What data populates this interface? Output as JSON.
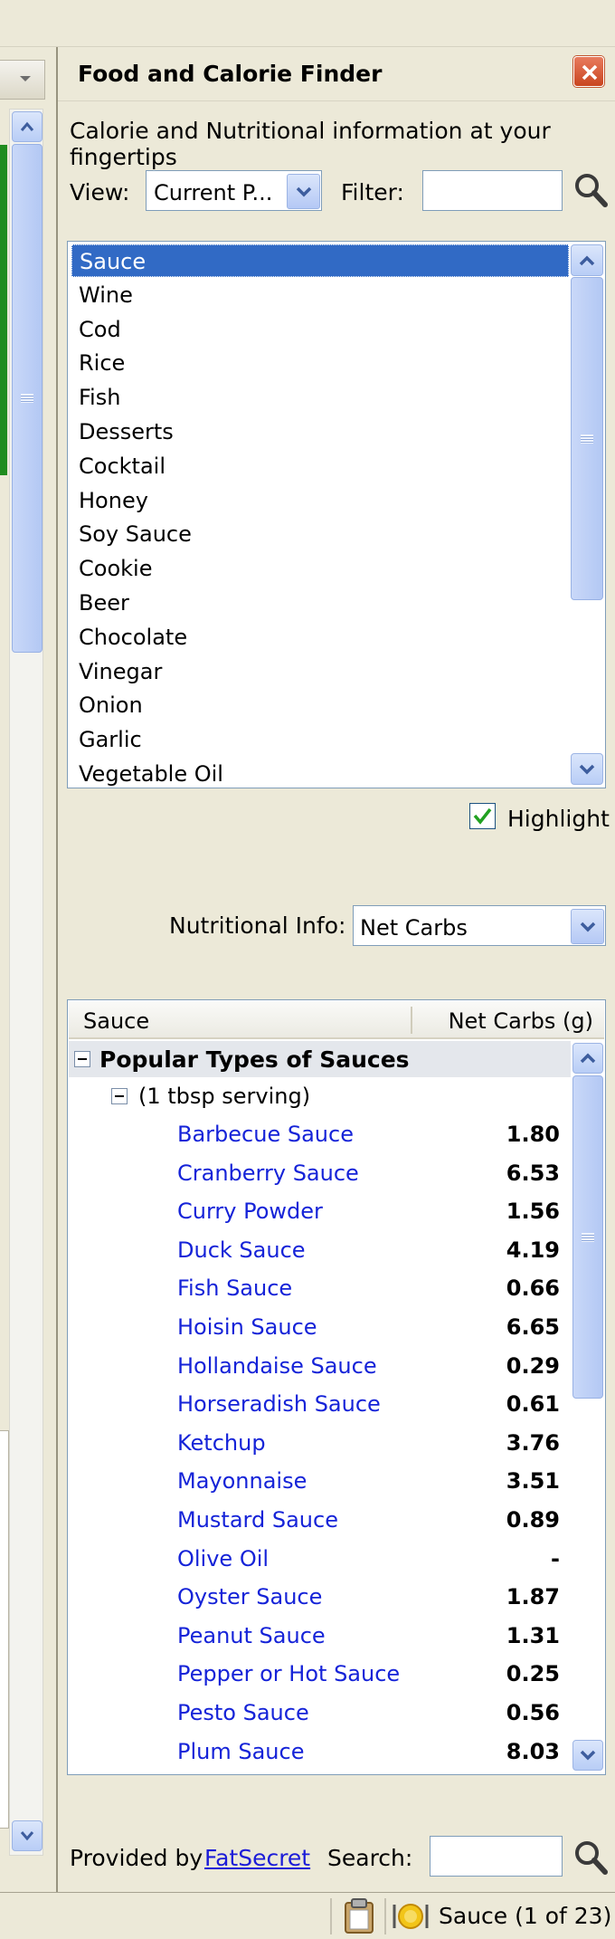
{
  "panel": {
    "title": "Food and Calorie Finder",
    "tagline": "Calorie and Nutritional information at your fingertips"
  },
  "view": {
    "label": "View:",
    "selected": "Current P..."
  },
  "filter": {
    "label": "Filter:",
    "value": ""
  },
  "food_list": {
    "items": [
      "Sauce",
      "Wine",
      "Cod",
      "Rice",
      "Fish",
      "Desserts",
      "Cocktail",
      "Honey",
      "Soy Sauce",
      "Cookie",
      "Beer",
      "Chocolate",
      "Vinegar",
      "Onion",
      "Garlic",
      "Vegetable Oil"
    ],
    "selected_index": 0
  },
  "highlight": {
    "label": "Highlight",
    "checked": true
  },
  "nutritional_info": {
    "label": "Nutritional Info:",
    "selected": "Net Carbs"
  },
  "grid": {
    "columns": [
      "Sauce",
      "Net Carbs (g)"
    ],
    "group": "Popular Types of Sauces",
    "subgroup": "(1 tbsp serving)",
    "rows": [
      {
        "name": "Barbecue Sauce",
        "value": "1.80"
      },
      {
        "name": "Cranberry Sauce",
        "value": "6.53"
      },
      {
        "name": "Curry Powder",
        "value": "1.56"
      },
      {
        "name": "Duck Sauce",
        "value": "4.19"
      },
      {
        "name": "Fish Sauce",
        "value": "0.66"
      },
      {
        "name": "Hoisin Sauce",
        "value": "6.65"
      },
      {
        "name": "Hollandaise Sauce",
        "value": "0.29"
      },
      {
        "name": "Horseradish Sauce",
        "value": "0.61"
      },
      {
        "name": "Ketchup",
        "value": "3.76"
      },
      {
        "name": "Mayonnaise",
        "value": "3.51"
      },
      {
        "name": "Mustard Sauce",
        "value": "0.89"
      },
      {
        "name": "Olive Oil",
        "value": "-"
      },
      {
        "name": "Oyster Sauce",
        "value": "1.87"
      },
      {
        "name": "Peanut Sauce",
        "value": "1.31"
      },
      {
        "name": "Pepper or Hot Sauce",
        "value": "0.25"
      },
      {
        "name": "Pesto Sauce",
        "value": "0.56"
      },
      {
        "name": "Plum Sauce",
        "value": "8.03"
      }
    ]
  },
  "footer": {
    "provided_by": "Provided by",
    "provider": "FatSecret",
    "search_label": "Search:",
    "search_value": ""
  },
  "status": {
    "text": "Sauce (1 of 23)"
  },
  "icons": {
    "close": "close-icon",
    "search": "magnifier-icon",
    "dropdown": "chevron-down-icon",
    "scroll_up": "chevron-up-icon",
    "scroll_down": "chevron-down-icon",
    "checkbox": "checkmark-icon",
    "clipboard": "clipboard-icon",
    "food": "food-plate-icon"
  },
  "colors": {
    "background": "#ece9d8",
    "selection": "#316ac5",
    "link": "#1523d8",
    "close_button": "#d4532c",
    "scroll_accent": "#b8cdf6"
  }
}
